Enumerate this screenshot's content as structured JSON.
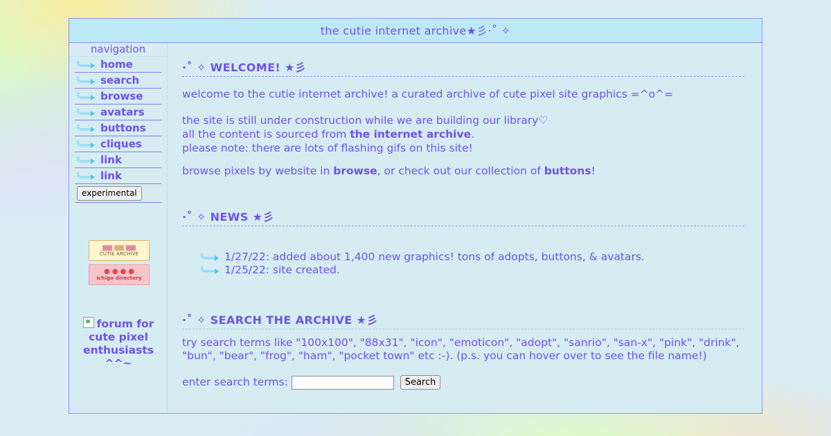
{
  "header": {
    "title": "the cutie internet archive★彡·˚ ✧"
  },
  "sidebar": {
    "nav_title": "navigation",
    "items": [
      {
        "label": "home"
      },
      {
        "label": "search"
      },
      {
        "label": "browse"
      },
      {
        "label": "avatars"
      },
      {
        "label": "buttons"
      },
      {
        "label": "cliques"
      },
      {
        "label": "link"
      },
      {
        "label": "link"
      }
    ],
    "experimental_button": "experimental",
    "badge1_text": "CUTIE ARCHIVE",
    "badge2_text": "ichigo directory",
    "forum_text": "forum for cute pixel enthusiasts ^^~"
  },
  "welcome": {
    "title": "·˚ ✧ WELCOME! ★彡",
    "line1": "welcome to the cutie internet archive! a curated archive of cute pixel site graphics =^o^=",
    "line2": "the site is still under construction while we are building our library♡",
    "line3_pre": "all the content is sourced from ",
    "line3_bold": "the internet archive",
    "line3_post": ".",
    "line4": "please note: there are lots of flashing gifs on this site!",
    "line5_pre": "browse pixels by website in ",
    "line5_bold1": "browse",
    "line5_mid": ", or check out our collection of ",
    "line5_bold2": "buttons",
    "line5_post": "!"
  },
  "news": {
    "title": "·˚ ✧ NEWS ★彡",
    "items": [
      {
        "text": "1/27/22: added about 1,400 new graphics! tons of adopts, buttons, & avatars."
      },
      {
        "text": "1/25/22: site created."
      }
    ]
  },
  "search": {
    "title": "·˚ ✧ SEARCH THE ARCHIVE ★彡",
    "hint": "try search terms like \"100x100\", \"88x31\", \"icon\", \"emoticon\", \"adopt\", \"sanrio\", \"san-x\", \"pink\", \"drink\", \"bun\", \"bear\", \"frog\", \"ham\", \"pocket town\" etc :-). (p.s. you can hover over to see the file name!)",
    "label": "enter search terms:",
    "input_value": "",
    "button_label": "Search"
  },
  "colors": {
    "accent": "#7152e6",
    "border": "#9b8ff0",
    "header_bg": "#bde9f7",
    "panel_bg": "#d5ecf2",
    "arrow": "#4fc3f7"
  }
}
